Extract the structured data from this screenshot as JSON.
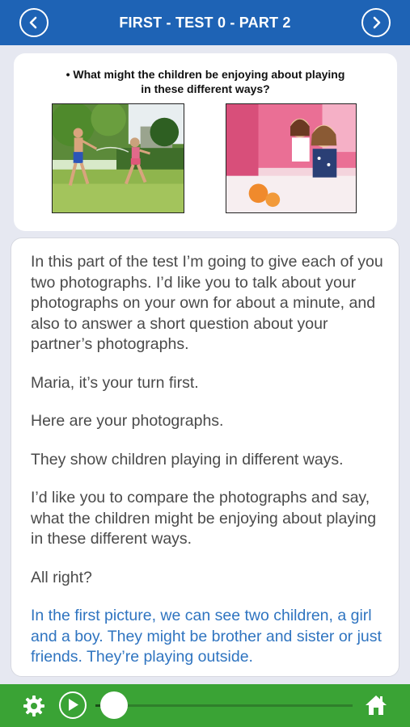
{
  "header": {
    "title": "FIRST - TEST 0 - PART 2",
    "back_icon": "chevron-left-icon",
    "forward_icon": "chevron-right-icon",
    "color": "#1e63b5"
  },
  "question": {
    "line1": "• What might the children be enjoying about playing",
    "line2": "in these different ways?"
  },
  "paragraphs": [
    "In this part of the test I’m going to give each of you two photographs. I’d like you to talk about your photographs on your own for about a minute, and also to answer a short question about your partner’s photographs.",
    "Maria, it’s your turn first.",
    "Here are your photographs.",
    "They show children playing in different ways.",
    "I’d like you to compare the photographs and say, what the children might be enjoying about playing in these different ways.",
    "All right?"
  ],
  "answer": "In the first picture, we can see two children, a girl and a boy. They might be brother and sister or just friends. They’re playing outside.",
  "player": {
    "settings_icon": "gear-icon",
    "play_icon": "play-icon",
    "home_icon": "home-icon",
    "progress": 0.02,
    "bar_color": "#3aa335"
  },
  "colors": {
    "answer_text": "#2f74c0",
    "body_text": "#4a4a4a"
  }
}
